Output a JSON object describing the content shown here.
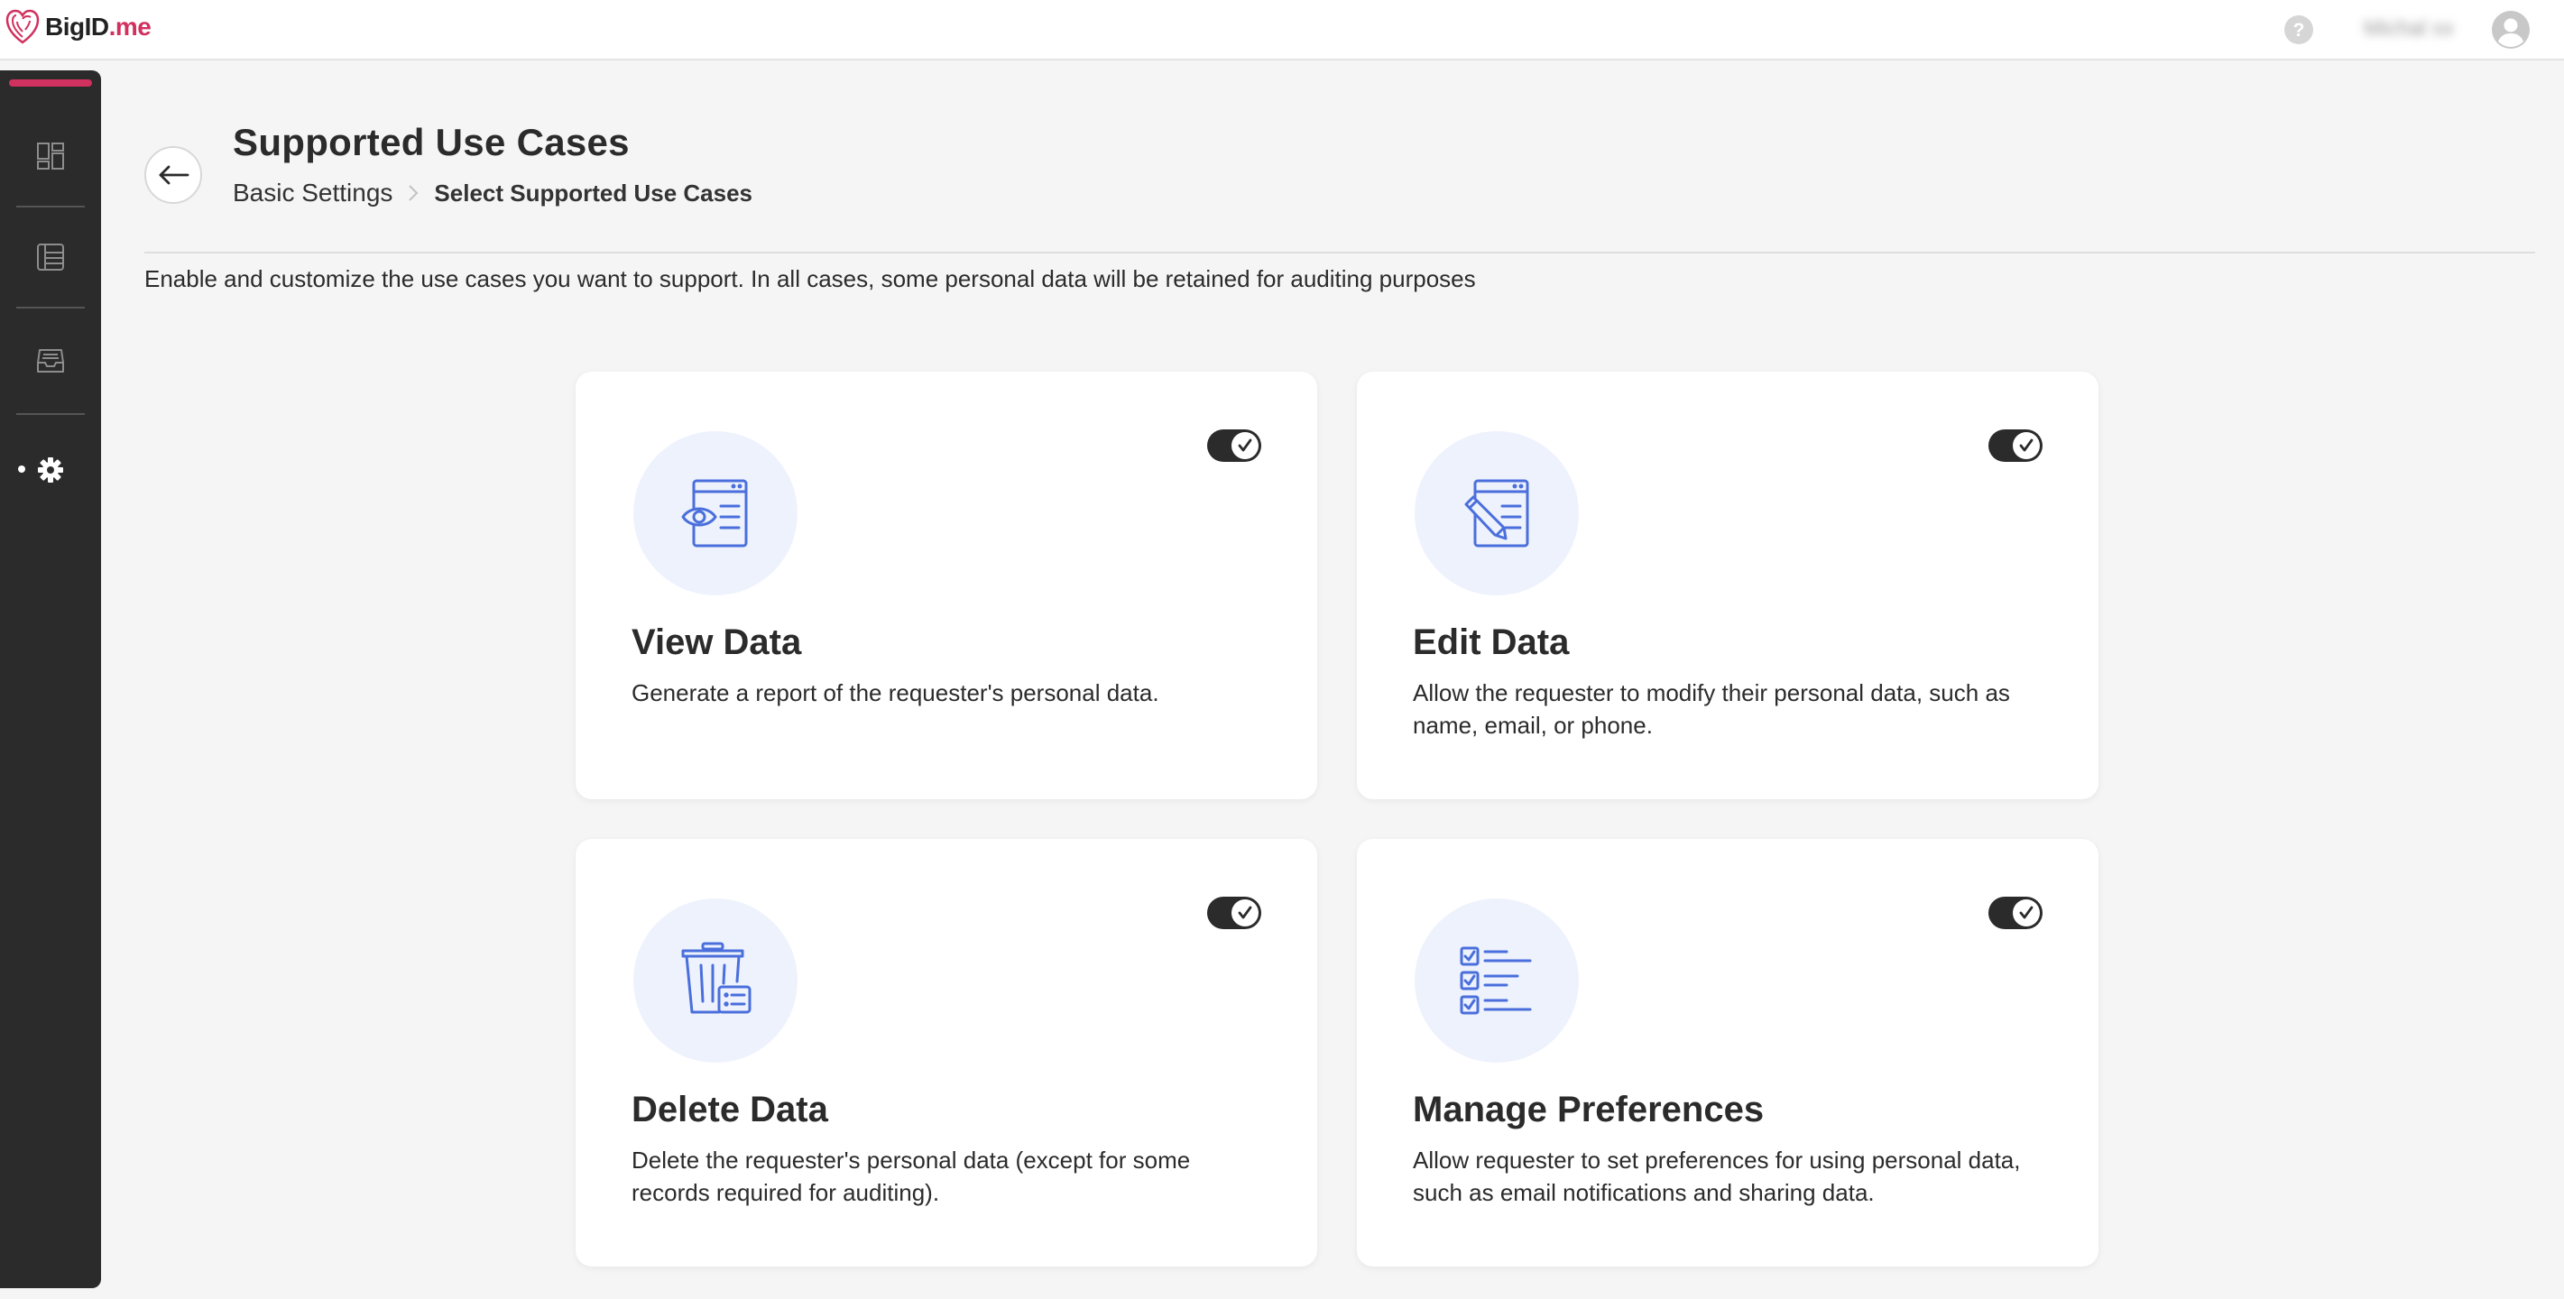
{
  "app": {
    "logo_text": "BigID",
    "logo_suffix": ".me",
    "user_name": "Michal xx"
  },
  "sidebar": {
    "items": [
      {
        "icon": "dashboard-icon"
      },
      {
        "icon": "table-icon"
      },
      {
        "icon": "inbox-icon"
      },
      {
        "icon": "gear-icon",
        "active": true
      }
    ]
  },
  "header": {
    "title": "Supported Use Cases",
    "breadcrumb": {
      "parent": "Basic Settings",
      "current": "Select Supported Use Cases"
    },
    "description": "Enable and customize the use cases you want to support. In all cases, some personal data will be retained for auditing purposes"
  },
  "use_cases": [
    {
      "title": "View Data",
      "description": "Generate a report of the requester's personal data.",
      "icon": "view-data-icon",
      "enabled": true
    },
    {
      "title": "Edit Data",
      "description": "Allow the requester to modify their personal data, such as name, email, or phone.",
      "icon": "edit-data-icon",
      "enabled": true
    },
    {
      "title": "Delete Data",
      "description": "Delete the requester's personal data (except for some records required for auditing).",
      "icon": "delete-data-icon",
      "enabled": true
    },
    {
      "title": "Manage Preferences",
      "description": "Allow requester to set preferences for using personal data, such as email notifications and sharing data.",
      "icon": "manage-preferences-icon",
      "enabled": true
    }
  ],
  "colors": {
    "accent": "#d0315e",
    "icon_blue": "#4a6fdc",
    "icon_bg": "#eef2fd",
    "sidebar_bg": "#2b2b2b"
  }
}
